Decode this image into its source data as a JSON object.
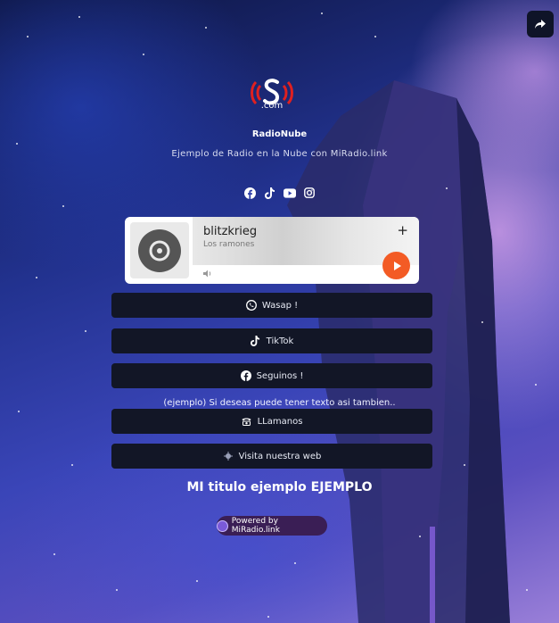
{
  "station": {
    "logo_text": ".com",
    "name": "RadioNube",
    "description": "Ejemplo de Radio en la Nube con MiRadio.link"
  },
  "share_button": {
    "icon": "share-arrow-icon"
  },
  "socials": [
    {
      "name": "facebook",
      "icon": "facebook-icon"
    },
    {
      "name": "tiktok",
      "icon": "tiktok-icon"
    },
    {
      "name": "youtube",
      "icon": "youtube-icon"
    },
    {
      "name": "instagram",
      "icon": "instagram-icon"
    }
  ],
  "player": {
    "title": "blitzkrieg",
    "artist": "Los ramones",
    "add_icon": "+",
    "play_color": "#f35b25"
  },
  "links": [
    {
      "label": "Wasap !",
      "icon": "whatsapp-icon"
    },
    {
      "label": "TikTok",
      "icon": "tiktok-icon"
    },
    {
      "label": "Seguinos !",
      "icon": "facebook-icon"
    },
    {
      "label": "LLamanos",
      "icon": "phone-icon"
    },
    {
      "label": "Visita nuestra web",
      "icon": "globe-icon"
    }
  ],
  "note": "(ejemplo) Si deseas puede tener texto asi tambien..",
  "heading": "MI titulo ejemplo EJEMPLO",
  "powered_by": "Powered by MiRadio.link"
}
